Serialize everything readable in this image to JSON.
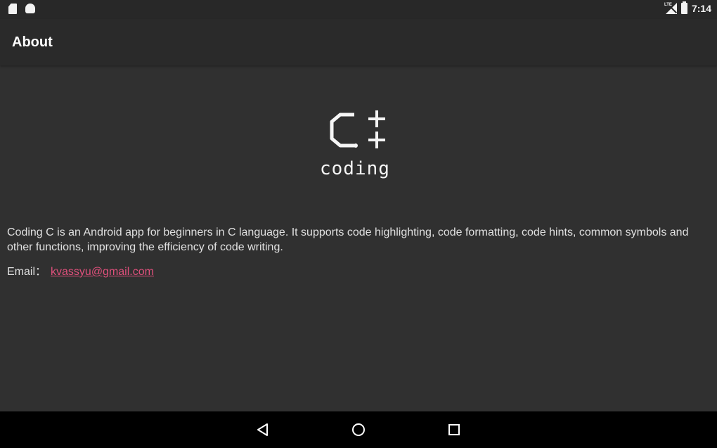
{
  "status_bar": {
    "left_icons": [
      "sd-card-icon",
      "android-icon"
    ],
    "right_icons": [
      "signal-icon",
      "battery-icon"
    ],
    "signal_label": "LTE",
    "time": "7:14"
  },
  "app_bar": {
    "title": "About"
  },
  "logo": {
    "glyph": "C++",
    "word": "coding"
  },
  "about": {
    "description": "Coding C is an Android app for beginners in C language. It supports code highlighting, code formatting, code hints, common symbols and other functions, improving the efficiency of code writing.",
    "email_label": "Email：",
    "email_value": "kvassyu@gmail.com"
  },
  "nav_bar": {
    "buttons": [
      "back-icon",
      "home-icon",
      "recents-icon"
    ]
  },
  "colors": {
    "background": "#303030",
    "app_bar": "#2a2a2a",
    "link": "#e0507c",
    "nav_bar": "#000000"
  }
}
